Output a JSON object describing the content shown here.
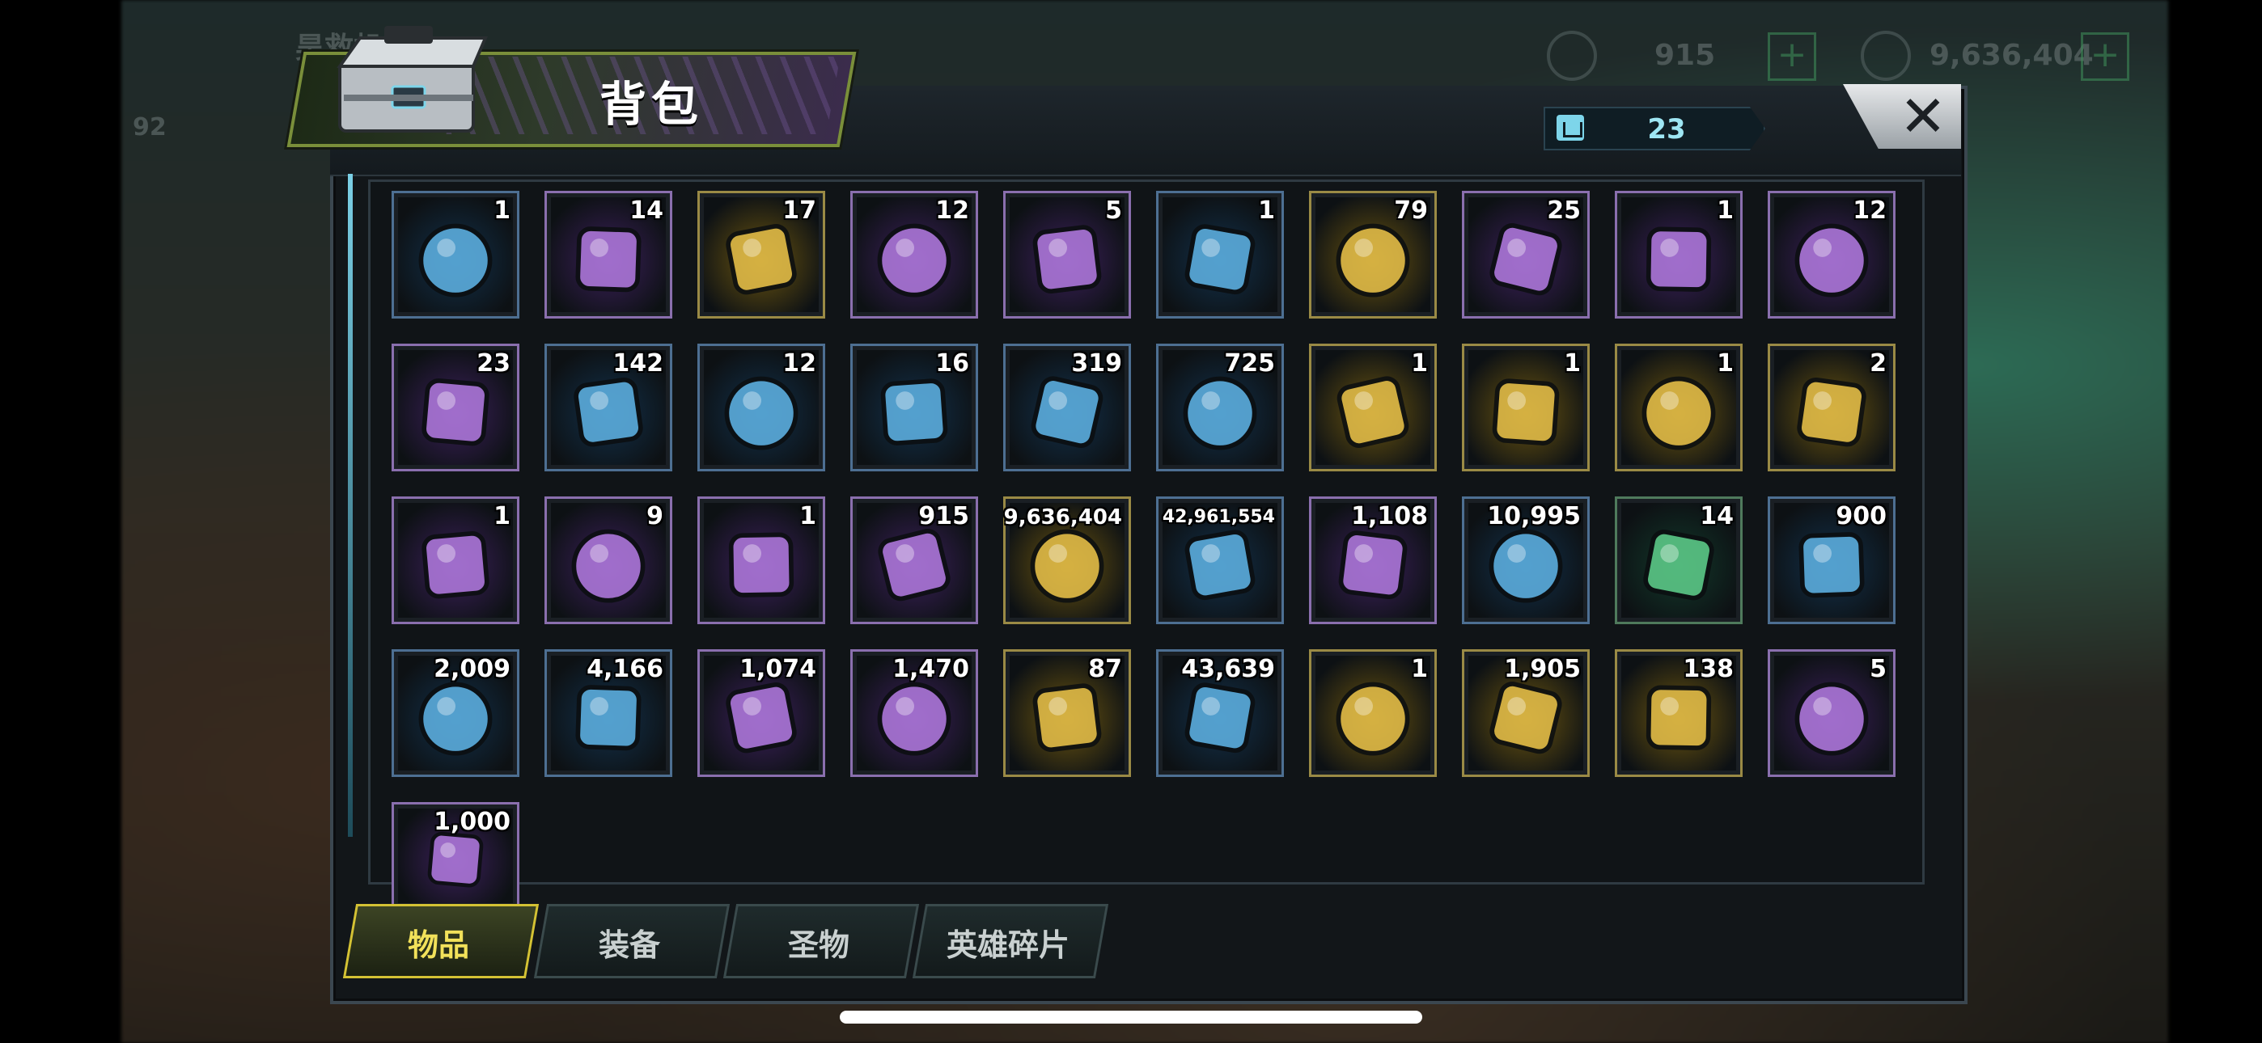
{
  "hud": {
    "title_blur": "昊救机",
    "level": "92",
    "currency_a": "915",
    "currency_b": "9,636,404"
  },
  "window": {
    "title": "背包",
    "capacity_value": "23",
    "close_label": "✕"
  },
  "items": [
    {
      "count": "1",
      "rarity": "blue",
      "icon": "treasure-chest-icon"
    },
    {
      "count": "14",
      "rarity": "purple",
      "icon": "hourglass-swirl-icon"
    },
    {
      "count": "17",
      "rarity": "gold",
      "icon": "24h-gold-speedup-card-icon"
    },
    {
      "count": "12",
      "rarity": "purple",
      "icon": "12h-token-card-icon"
    },
    {
      "count": "5",
      "rarity": "purple",
      "icon": "12h-gold-card-icon"
    },
    {
      "count": "1",
      "rarity": "blue",
      "icon": "4h-gold-card-icon"
    },
    {
      "count": "79",
      "rarity": "gold",
      "icon": "red-bottlecap-icon"
    },
    {
      "count": "25",
      "rarity": "purple",
      "icon": "film-reel-icon"
    },
    {
      "count": "1",
      "rarity": "purple",
      "icon": "pink-bottlecap-icon"
    },
    {
      "count": "12",
      "rarity": "purple",
      "icon": "casino-chip-icon"
    },
    {
      "count": "23",
      "rarity": "purple",
      "icon": "police-badge-icon"
    },
    {
      "count": "142",
      "rarity": "blue",
      "icon": "cinema-ticket-icon"
    },
    {
      "count": "12",
      "rarity": "blue",
      "icon": "timer-token-icon"
    },
    {
      "count": "16",
      "rarity": "blue",
      "icon": "blue-bottlecap-icon"
    },
    {
      "count": "319",
      "rarity": "blue",
      "icon": "red-poker-chip-icon"
    },
    {
      "count": "725",
      "rarity": "blue",
      "icon": "bullet-icon"
    },
    {
      "count": "1",
      "rarity": "gold",
      "icon": "revolver-blueprint-icon"
    },
    {
      "count": "1",
      "rarity": "gold",
      "icon": "boot-blueprint-icon"
    },
    {
      "count": "1",
      "rarity": "gold",
      "icon": "crossed-swords-blueprint-icon"
    },
    {
      "count": "2",
      "rarity": "gold",
      "icon": "hat-blueprint-icon"
    },
    {
      "count": "1",
      "rarity": "purple",
      "icon": "hat-purple-blueprint-icon"
    },
    {
      "count": "9",
      "rarity": "purple",
      "icon": "shirt-purple-blueprint-icon"
    },
    {
      "count": "1",
      "rarity": "purple",
      "icon": "boot-purple-blueprint-icon"
    },
    {
      "count": "915",
      "rarity": "purple",
      "icon": "purple-gem-icon"
    },
    {
      "count": "9,636,404",
      "rarity": "gold",
      "icon": "gold-coin-stack-icon"
    },
    {
      "count": "42,961,554",
      "rarity": "blue",
      "icon": "green-canister-icon"
    },
    {
      "count": "1,108",
      "rarity": "purple",
      "icon": "purple-orb-icon"
    },
    {
      "count": "10,995",
      "rarity": "blue",
      "icon": "gear-icon"
    },
    {
      "count": "14",
      "rarity": "green",
      "icon": "red-node-token-icon"
    },
    {
      "count": "900",
      "rarity": "blue",
      "icon": "eye-gem-icon"
    },
    {
      "count": "2,009",
      "rarity": "blue",
      "icon": "crystal-triangle-icon"
    },
    {
      "count": "4,166",
      "rarity": "blue",
      "icon": "golden-fist-icon"
    },
    {
      "count": "1,074",
      "rarity": "purple",
      "icon": "puzzle-piece-icon"
    },
    {
      "count": "1,470",
      "rarity": "purple",
      "icon": "boat-medal-blue-icon"
    },
    {
      "count": "87",
      "rarity": "gold",
      "icon": "boat-medal-gold-icon"
    },
    {
      "count": "43,639",
      "rarity": "blue",
      "icon": "red-radiation-icon"
    },
    {
      "count": "1",
      "rarity": "gold",
      "icon": "star-triangle-icon"
    },
    {
      "count": "1,905",
      "rarity": "gold",
      "icon": "ruby-crystal-icon"
    },
    {
      "count": "138",
      "rarity": "gold",
      "icon": "gold-coins-icon"
    },
    {
      "count": "5",
      "rarity": "purple",
      "icon": "red-target-gem-icon"
    },
    {
      "count": "1,000",
      "rarity": "purple",
      "icon": "purple-sphere-icon"
    }
  ],
  "tabs": [
    {
      "label": "物品",
      "active": true
    },
    {
      "label": "装备",
      "active": false
    },
    {
      "label": "圣物",
      "active": false
    },
    {
      "label": "英雄碎片",
      "active": false
    }
  ],
  "colors": {
    "accent_gold": "#f2e15a",
    "capacity_text": "#9ee6f3"
  }
}
